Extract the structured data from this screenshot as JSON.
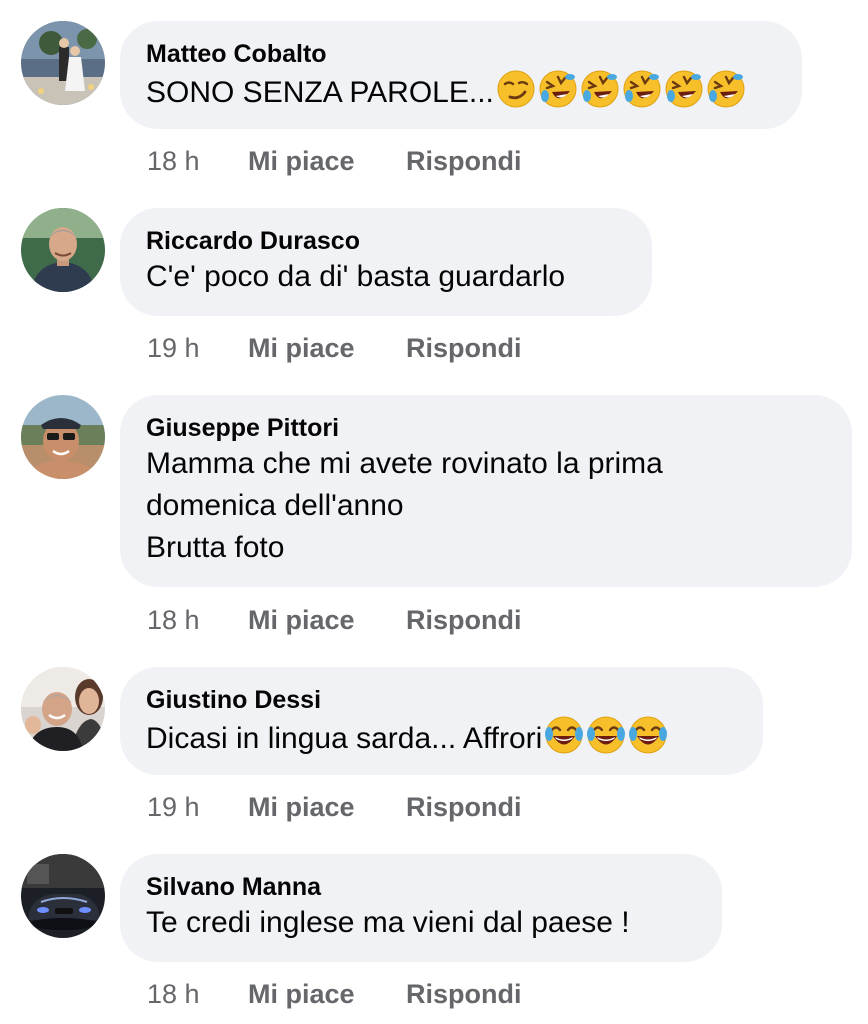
{
  "comments": [
    {
      "author": "Matteo Cobalto",
      "lines": [
        "SONO SENZA PAROLE..."
      ],
      "emojis": [
        "smirk-emoji",
        "rofl-emoji",
        "rofl-emoji",
        "rofl-emoji",
        "rofl-emoji",
        "rofl-emoji"
      ],
      "time": "18 h",
      "like_label": "Mi piace",
      "reply_label": "Rispondi"
    },
    {
      "author": "Riccardo Durasco",
      "lines": [
        "C'e' poco da di' basta guardarlo"
      ],
      "emojis": [],
      "time": "19 h",
      "like_label": "Mi piace",
      "reply_label": "Rispondi"
    },
    {
      "author": "Giuseppe Pittori",
      "lines": [
        "Mamma che mi avete rovinato la prima",
        "domenica dell'anno",
        "Brutta foto"
      ],
      "emojis": [],
      "time": "18 h",
      "like_label": "Mi piace",
      "reply_label": "Rispondi"
    },
    {
      "author": "Giustino Dessi",
      "lines": [
        "Dicasi in lingua sarda... Affrori"
      ],
      "emojis": [
        "joy-emoji",
        "joy-emoji",
        "joy-emoji"
      ],
      "time": "19 h",
      "like_label": "Mi piace",
      "reply_label": "Rispondi"
    },
    {
      "author": "Silvano Manna",
      "lines": [
        "Te credi inglese ma vieni dal paese !"
      ],
      "emojis": [],
      "time": "18 h",
      "like_label": "Mi piace",
      "reply_label": "Rispondi"
    }
  ]
}
